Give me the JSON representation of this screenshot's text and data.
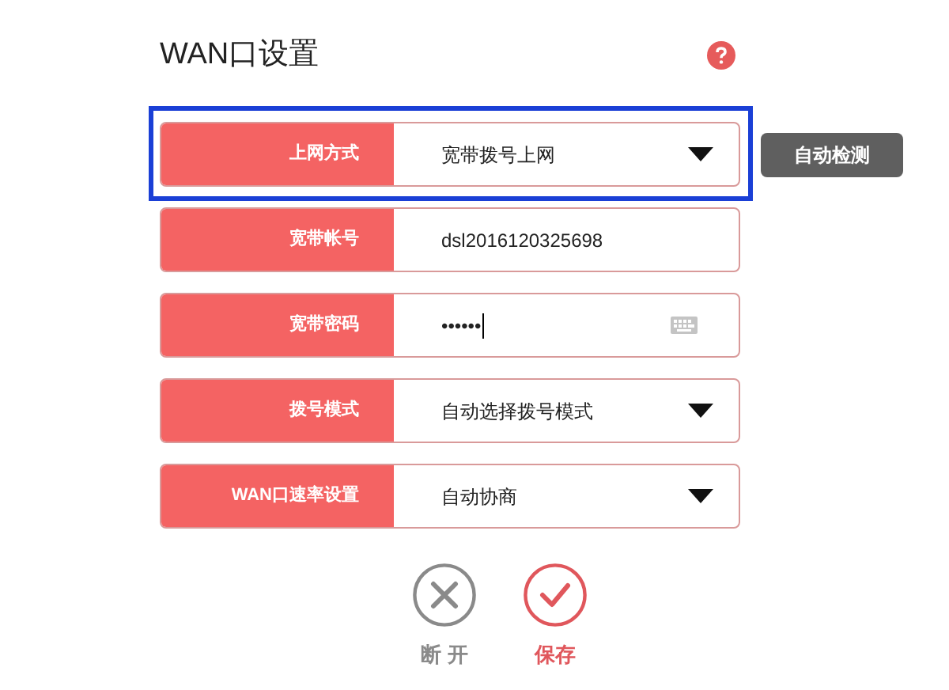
{
  "title": "WAN口设置",
  "fields": [
    {
      "kind": "select",
      "label": "上网方式",
      "value": "宽带拨号上网",
      "highlighted": true,
      "action": "自动检测"
    },
    {
      "kind": "text",
      "label": "宽带帐号",
      "value": "dsl2016120325698",
      "highlighted": false
    },
    {
      "kind": "password",
      "label": "宽带密码",
      "value": "••••••",
      "highlighted": false,
      "focused": true
    },
    {
      "kind": "select",
      "label": "拨号模式",
      "value": "自动选择拨号模式",
      "highlighted": false
    },
    {
      "kind": "select",
      "label": "WAN口速率设置",
      "value": "自动协商",
      "highlighted": false
    }
  ],
  "buttons": [
    {
      "kind": "disconnect",
      "label": "断 开"
    },
    {
      "kind": "save",
      "label": "保存"
    }
  ]
}
